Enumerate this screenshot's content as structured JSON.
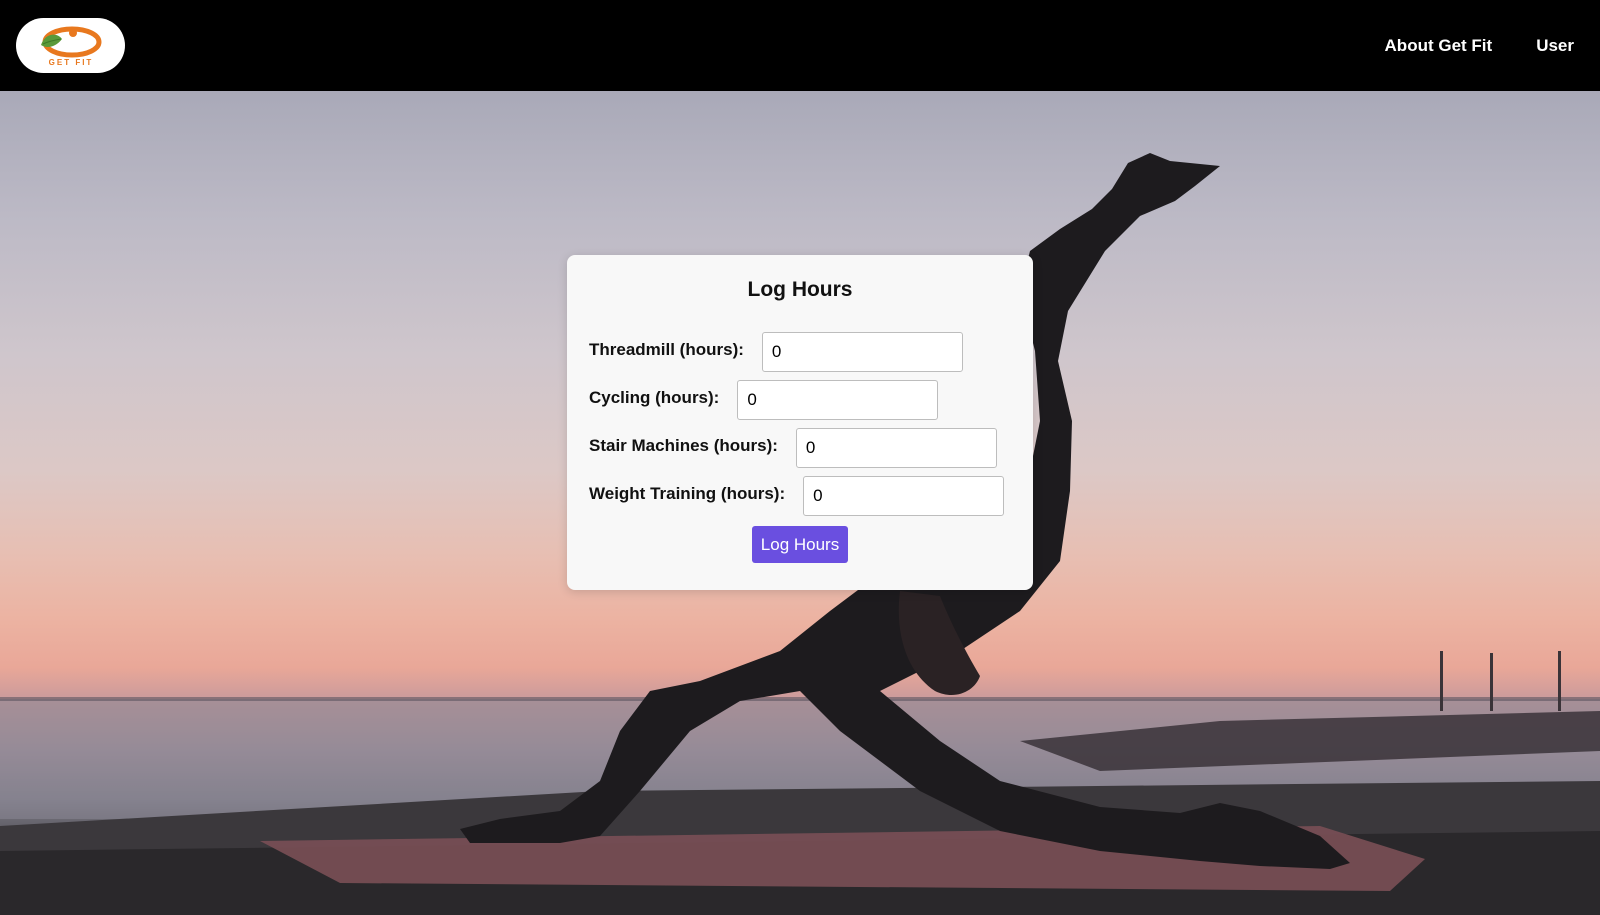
{
  "header": {
    "logo_text": "GET FIT",
    "nav": [
      {
        "label": "About Get Fit"
      },
      {
        "label": "User"
      }
    ]
  },
  "form": {
    "title": "Log Hours",
    "fields": [
      {
        "label": "Threadmill (hours):",
        "value": "0"
      },
      {
        "label": "Cycling (hours):",
        "value": "0"
      },
      {
        "label": "Stair Machines (hours):",
        "value": "0"
      },
      {
        "label": "Weight Training (hours):",
        "value": "0"
      }
    ],
    "submit_label": "Log Hours"
  },
  "colors": {
    "navbar": "#000000",
    "card": "#f8f8f8",
    "button": "#6a4fe0",
    "logo_orange": "#e8781e",
    "logo_green": "#5a9a3a"
  }
}
